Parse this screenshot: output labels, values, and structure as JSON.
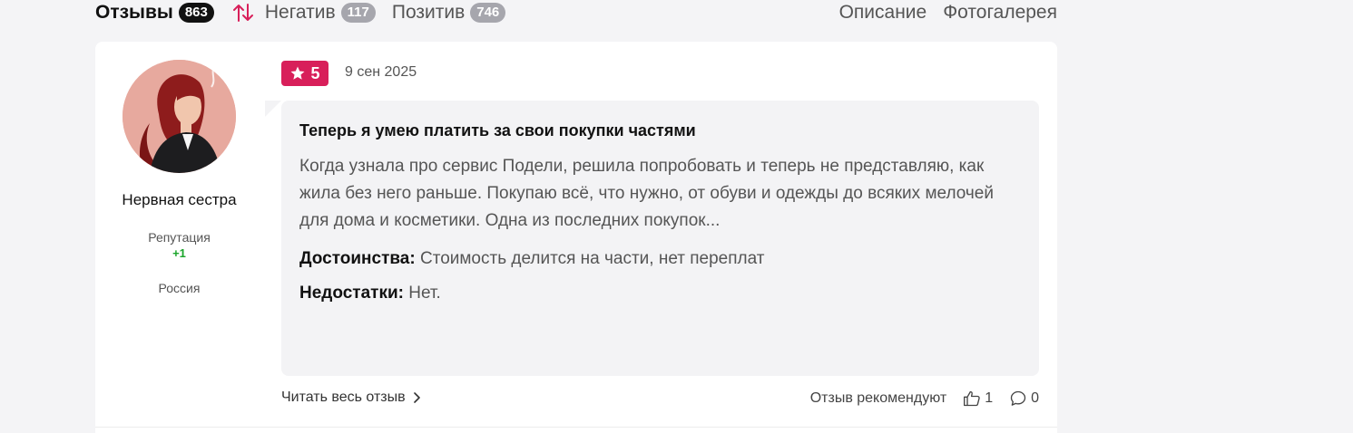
{
  "tabs": {
    "reviews": {
      "label": "Отзывы",
      "count": "863"
    },
    "negative": {
      "label": "Негатив",
      "count": "117"
    },
    "positive": {
      "label": "Позитив",
      "count": "746"
    },
    "description": "Описание",
    "gallery": "Фотогалерея"
  },
  "colors": {
    "accent": "#d81f5a",
    "reputation": "#1aa52a",
    "badge_active": "#111111",
    "badge_inactive": "#a6a6ad"
  },
  "review": {
    "author": {
      "name": "Нервная сестра",
      "reputation_label": "Репутация",
      "reputation_value": "+1",
      "country": "Россия"
    },
    "rating": "5",
    "date": "9 сен 2025",
    "title": "Теперь я умею платить за свои покупки частями",
    "text": "Когда узнала про сервис Подели, решила попробовать и теперь не представляю, как жила без него раньше. Покупаю всё, что нужно, от обуви и одежды до всяких мелочей для дома и косметики. Одна из последних покупок...",
    "pros_label": "Достоинства:",
    "pros": "Стоимость делится на части, нет переплат",
    "cons_label": "Недостатки:",
    "cons": "Нет.",
    "read_more": "Читать весь отзыв",
    "recommend_label": "Отзыв рекомендуют",
    "likes": "1",
    "comments": "0"
  }
}
